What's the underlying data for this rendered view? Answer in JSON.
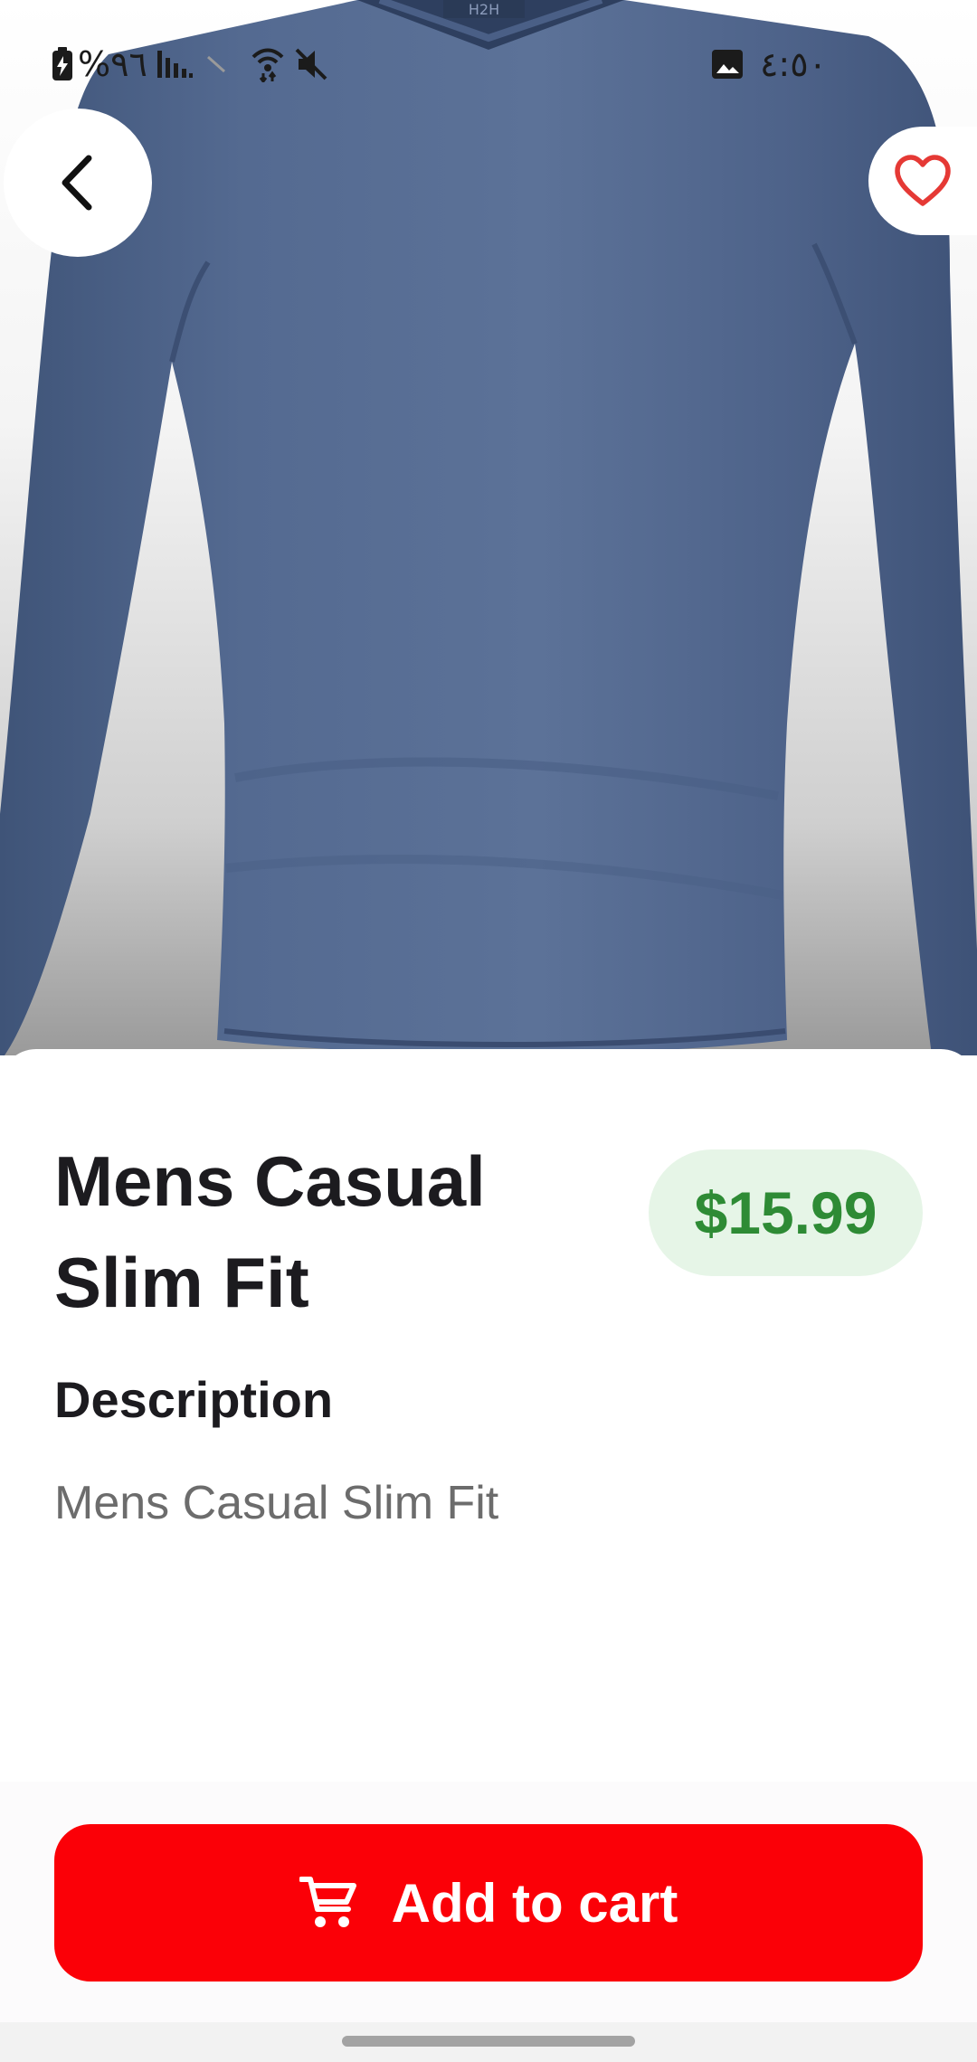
{
  "status_bar": {
    "battery_percent": "%٩٦",
    "time": "٤:٥٠"
  },
  "product": {
    "title": "Mens Casual Slim Fit",
    "price": "$15.99",
    "image_label": "H2H"
  },
  "description": {
    "heading": "Description",
    "text": "Mens Casual Slim Fit"
  },
  "actions": {
    "add_to_cart_label": "Add to cart"
  },
  "icons": {
    "back": "chevron-left-icon",
    "favorite": "heart-outline-icon",
    "cart": "shopping-cart-icon"
  },
  "colors": {
    "accent_red": "#fb0007",
    "price_green": "#2e8b35",
    "price_badge_bg": "#e6f5e7",
    "favorite_red": "#e53935"
  }
}
